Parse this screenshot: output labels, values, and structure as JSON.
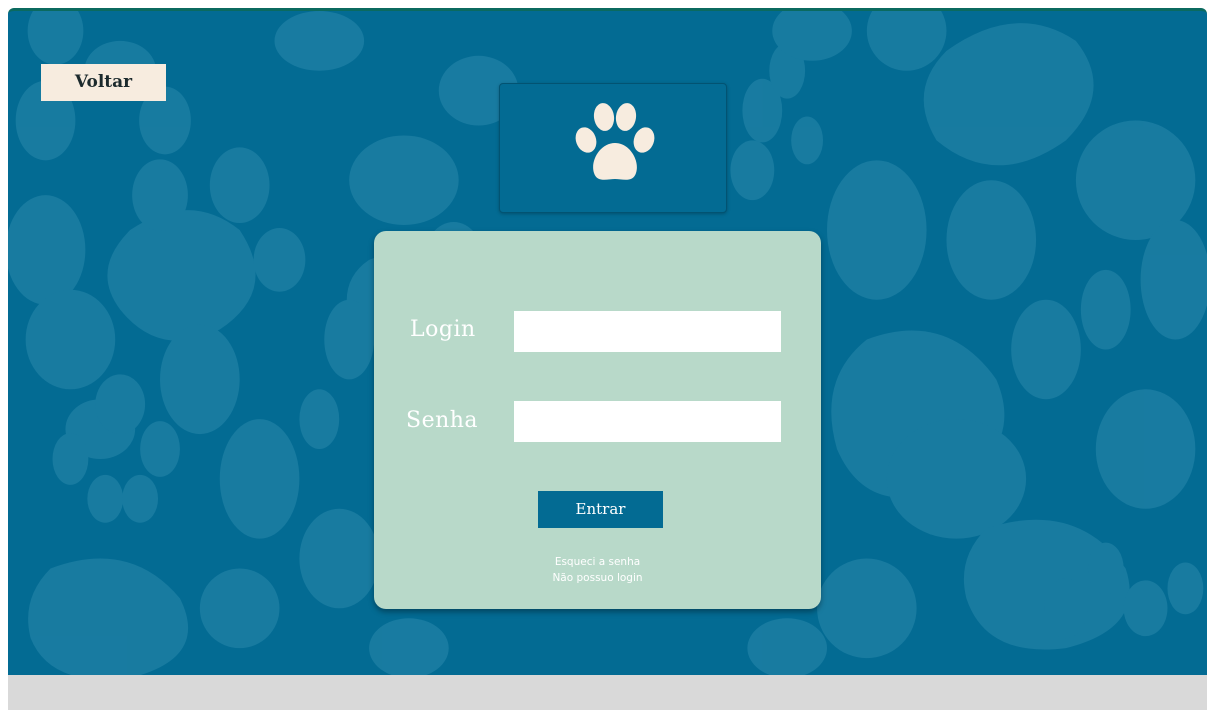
{
  "header": {
    "back_label": "Voltar"
  },
  "logo": {
    "icon": "paw-icon"
  },
  "login_form": {
    "login_label": "Login",
    "login_value": "",
    "password_label": "Senha",
    "password_value": "",
    "submit_label": "Entrar",
    "forgot_password_link": "Esqueci a senha",
    "no_login_link": "Não possuo login"
  },
  "colors": {
    "background": "#036b93",
    "paw_pattern": "#1c7ea3",
    "card": "#b8d9c9",
    "back_button": "#f7ecdf",
    "paw_logo": "#f7ecdf",
    "primary_button": "#036b93",
    "footer": "#d9d9d9"
  }
}
